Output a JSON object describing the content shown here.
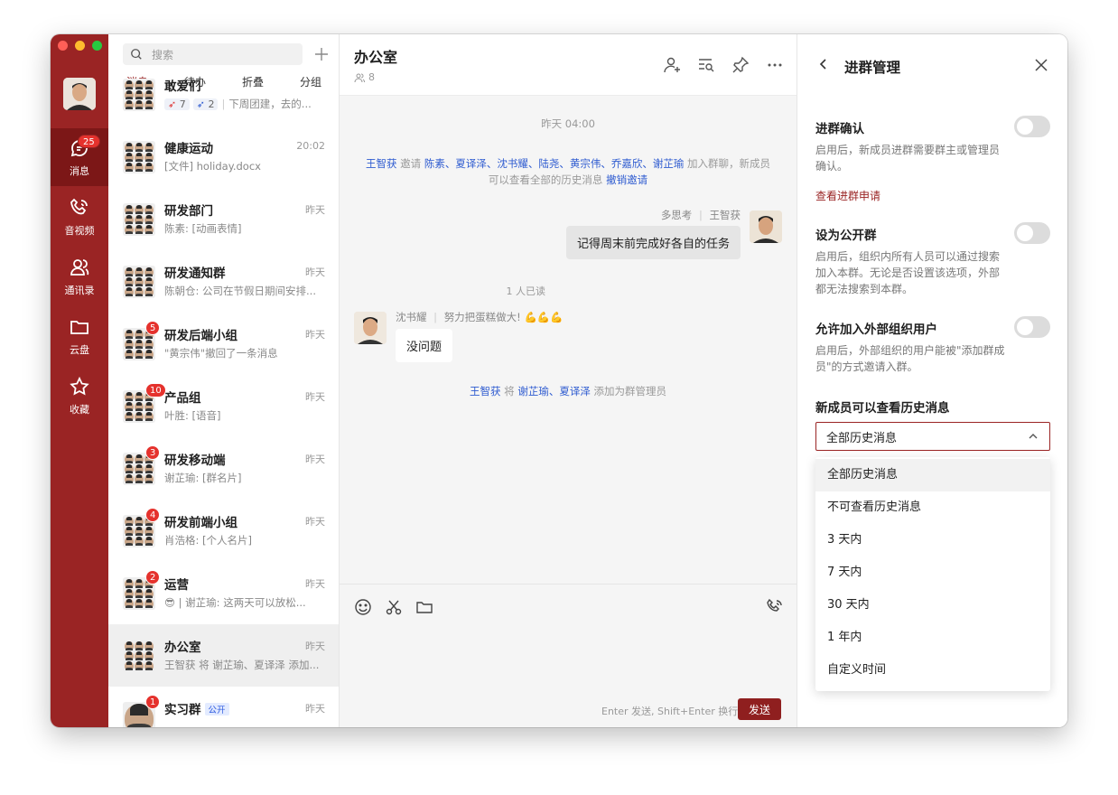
{
  "rail": {
    "items": [
      {
        "label": "消息",
        "badge": "25"
      },
      {
        "label": "音视频"
      },
      {
        "label": "通讯录"
      },
      {
        "label": "云盘"
      },
      {
        "label": "收藏"
      }
    ]
  },
  "list": {
    "search_placeholder": "搜索",
    "tabs": [
      "消息",
      "待办",
      "折叠",
      "分组"
    ],
    "top_partial": {
      "name": "敢爱们",
      "reactions": [
        "7",
        "2"
      ],
      "preview": "下周团建，去的..."
    },
    "items": [
      {
        "name": "健康运动",
        "time": "20:02",
        "preview": "[文件] holiday.docx"
      },
      {
        "name": "研发部门",
        "time": "昨天",
        "preview": "陈素: [动画表情]"
      },
      {
        "name": "研发通知群",
        "time": "昨天",
        "preview": "陈朝仓: 公司在节假日期间安排..."
      },
      {
        "name": "研发后端小组",
        "time": "昨天",
        "preview": "\"黄宗伟\"撤回了一条消息",
        "badge": "5"
      },
      {
        "name": "产品组",
        "time": "昨天",
        "preview": "叶胜: [语音]",
        "badge": "10"
      },
      {
        "name": "研发移动端",
        "time": "昨天",
        "preview": "谢芷瑜: [群名片]",
        "badge": "3"
      },
      {
        "name": "研发前端小组",
        "time": "昨天",
        "preview": "肖浩格: [个人名片]",
        "badge": "4"
      },
      {
        "name": "运营",
        "time": "昨天",
        "preview": "😎 | 谢芷瑜: 这两天可以放松...",
        "badge": "2"
      },
      {
        "name": "办公室",
        "time": "昨天",
        "preview": "王智获 将 谢芷瑜、夏译泽 添加..."
      },
      {
        "name": "实习群",
        "time": "昨天",
        "tag": "公开",
        "badge": "1"
      }
    ]
  },
  "chat": {
    "title": "办公室",
    "member_count": "8",
    "time_divider": "昨天 04:00",
    "invite": {
      "inviter": "王智获",
      "verb": "邀请",
      "invitees": "陈素、夏译泽、沈书耀、陆尧、黄宗伟、乔嘉欣、谢芷瑜",
      "suffix": "加入群聊，新成员",
      "line2": "可以查看全部的历史消息",
      "undo": "撤销邀请"
    },
    "msg1": {
      "tag": "多思考",
      "sender": "王智获",
      "text": "记得周末前完成好各自的任务",
      "read": "1 人已读"
    },
    "msg2": {
      "sender": "沈书耀",
      "tag": "努力把蛋糕做大!",
      "emoji": "💪💪💪",
      "text": "没问题"
    },
    "admin_notice": {
      "actor": "王智获",
      "verb": "将",
      "targets": "谢芷瑜、夏译泽",
      "suffix": "添加为群管理员"
    },
    "send_hint": "Enter 发送, Shift+Enter 换行",
    "send_label": "发送"
  },
  "panel": {
    "title": "进群管理",
    "confirm": {
      "title": "进群确认",
      "desc": "启用后，新成员进群需要群主或管理员确认。",
      "link": "查看进群申请"
    },
    "public": {
      "title": "设为公开群",
      "desc": "启用后，组织内所有人员可以通过搜索加入本群。无论是否设置该选项，外部都无法搜索到本群。"
    },
    "external": {
      "title": "允许加入外部组织用户",
      "desc": "启用后，外部组织的用户能被\"添加群成员\"的方式邀请入群。"
    },
    "history": {
      "title": "新成员可以查看历史消息",
      "selected": "全部历史消息",
      "options": [
        "全部历史消息",
        "不可查看历史消息",
        "3 天内",
        "7 天内",
        "30 天内",
        "1 年内",
        "自定义时间"
      ]
    }
  },
  "colors": {
    "brand": "#9a2424",
    "link": "#2e5bd0",
    "badge": "#e5322d"
  }
}
